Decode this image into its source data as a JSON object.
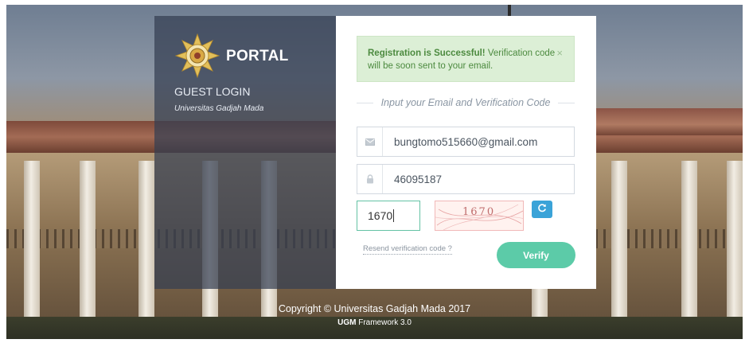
{
  "brand": {
    "name": "PORTAL",
    "subtitle": "GUEST LOGIN",
    "university": "Universitas Gadjah Mada"
  },
  "alert": {
    "strong": "Registration is Successful!",
    "message": " Verification code will be soon sent to your email.",
    "close_label": "×"
  },
  "form": {
    "instruction": "Input your Email and Verification Code",
    "email_value": "bungtomo515660@gmail.com",
    "code_value": "46095187",
    "captcha_value": "1670",
    "captcha_image_text": "1670",
    "resend_label": "Resend verification code ?",
    "verify_label": "Verify"
  },
  "footer": {
    "copyright": "Copyright © Universitas Gadjah Mada 2017",
    "framework_strong": "UGM",
    "framework_rest": " Framework 3.0"
  },
  "colors": {
    "accent": "#5ccba8",
    "alert_bg": "#dcefd6",
    "alert_text": "#4c8a3f",
    "refresh": "#3aa3d8"
  },
  "icons": {
    "email": "envelope-icon",
    "code": "lock-icon",
    "refresh": "refresh-icon",
    "close": "close-icon",
    "logo": "ugm-logo"
  }
}
